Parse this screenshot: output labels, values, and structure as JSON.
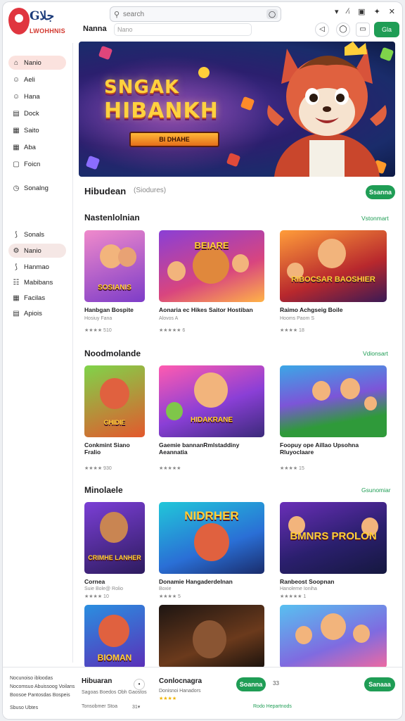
{
  "app": {
    "name": "Gجلا",
    "subtitle": "LWOHHNIS"
  },
  "search": {
    "placeholder": "search"
  },
  "window_controls": [
    "▾",
    "⁄ᵢ",
    "▣",
    "✦",
    "✕"
  ],
  "subheader": {
    "title": "Nanna",
    "filter_placeholder": "Nano",
    "buttons": [
      "◁",
      "◯",
      "▭"
    ],
    "pill": "Gla"
  },
  "sidebar": {
    "primary": [
      {
        "icon": "home-icon",
        "glyph": "⌂",
        "label": "Nanio",
        "active": true
      },
      {
        "icon": "smile-icon",
        "glyph": "☺",
        "label": "Aeli"
      },
      {
        "icon": "smile-icon",
        "glyph": "☺",
        "label": "Hana"
      },
      {
        "icon": "book-icon",
        "glyph": "▤",
        "label": "Dock"
      },
      {
        "icon": "calendar-icon",
        "glyph": "▦",
        "label": "Saito"
      },
      {
        "icon": "calendar-icon",
        "glyph": "▦",
        "label": "Aba"
      },
      {
        "icon": "doc-icon",
        "glyph": "▢",
        "label": "Foicn"
      },
      {
        "icon": "clock-icon",
        "glyph": "◷",
        "label": "Sonalng"
      }
    ],
    "secondary": [
      {
        "icon": "bolt-icon",
        "glyph": "⟆",
        "label": "Sonals"
      },
      {
        "icon": "gear-icon",
        "glyph": "⚙",
        "label": "Nanio",
        "active": true
      },
      {
        "icon": "bolt-icon",
        "glyph": "⟆",
        "label": "Hanmao"
      },
      {
        "icon": "chat-icon",
        "glyph": "☷",
        "label": "Mabibans"
      },
      {
        "icon": "grid-icon",
        "glyph": "▦",
        "label": "Facilas"
      },
      {
        "icon": "doc-icon",
        "glyph": "▤",
        "label": "Apiois"
      }
    ]
  },
  "hero": {
    "line1": "SNGAK",
    "line2": "HIBANKH",
    "ribbon": "Bl DHAHE"
  },
  "featured": {
    "title": "Hibudean",
    "subtitle": "(Siodures)",
    "button": "Ssanna"
  },
  "sections": [
    {
      "title": "Nastenlolnian",
      "more": "Vstonmart",
      "cards": [
        {
          "title": "Hanbgan Bospite",
          "sub": "Hosiuy\nFana",
          "rating": "★★★★ 510",
          "art": "SOSIANIS"
        },
        {
          "title": "Aonaria ec Hikes Saitor Hostiban",
          "sub": "Alovos\nA",
          "rating": "★★★★★ 6",
          "art": "BEIARE"
        },
        {
          "title": "Raimo Achgseig Boile",
          "sub": "Hooms Paom\nS",
          "rating": "★★★★ 18",
          "art": "RIBOCSAR BAOSHIER"
        }
      ]
    },
    {
      "title": "Noodmolande",
      "more": "Vdionsart",
      "cards": [
        {
          "title": "Conkmint Siano Fralio",
          "sub": "",
          "rating": "★★★★ 930",
          "art": "GHIDIE"
        },
        {
          "title": "Gaemie bannanRmlstaddiny Aeannatia",
          "sub": "",
          "rating": "★★★★★",
          "art": "HIDAKRANE"
        },
        {
          "title": "Foopuy ope Aillao Upsohna Rluyoclaare",
          "sub": "",
          "rating": "★★★★ 15",
          "art": ""
        }
      ]
    },
    {
      "title": "Minolaele",
      "more": "Gsunomiar",
      "cards": [
        {
          "title": "Cornea",
          "sub": "Suie Bole@ Rolio",
          "rating": "★★★★ 10",
          "art": "CRIMHE LANHER"
        },
        {
          "title": "Donamie Hangaderdelnan",
          "sub": "Boxie",
          "rating": "★★★★ 5",
          "art": "NIDRHER"
        },
        {
          "title": "Ranbeost Soopnan",
          "sub": "Hanoleme Ioniha",
          "rating": "★★★★★ 1",
          "art": "BMNRS PROLON"
        }
      ]
    },
    {
      "title": "",
      "more": "",
      "cards": [
        {
          "title": "",
          "sub": "",
          "rating": "",
          "art": "BIOMAN"
        },
        {
          "title": "",
          "sub": "",
          "rating": "",
          "art": ""
        },
        {
          "title": "",
          "sub": "",
          "rating": "",
          "art": ""
        }
      ]
    }
  ],
  "footer": {
    "links": [
      "Nocunoiso ibloodas",
      "Nocomsuo Abuissoog Voilans",
      "Boosoe Pantosdas Bospeis",
      "Sbuso Ubtes"
    ],
    "item1": {
      "title": "Hibuaran",
      "sub": "Sagoas Boedos Obh Gaostos",
      "meta": "Tonsobmer Stoa",
      "tiny": "31▾"
    },
    "item2": {
      "title": "Conlocnagra",
      "sub": "Donisnoi Hanadors",
      "rating": "★★★★",
      "button": "Soanna",
      "count": "33",
      "meta": "Rodo Hepartnods"
    },
    "button2": "Sanaaa"
  }
}
